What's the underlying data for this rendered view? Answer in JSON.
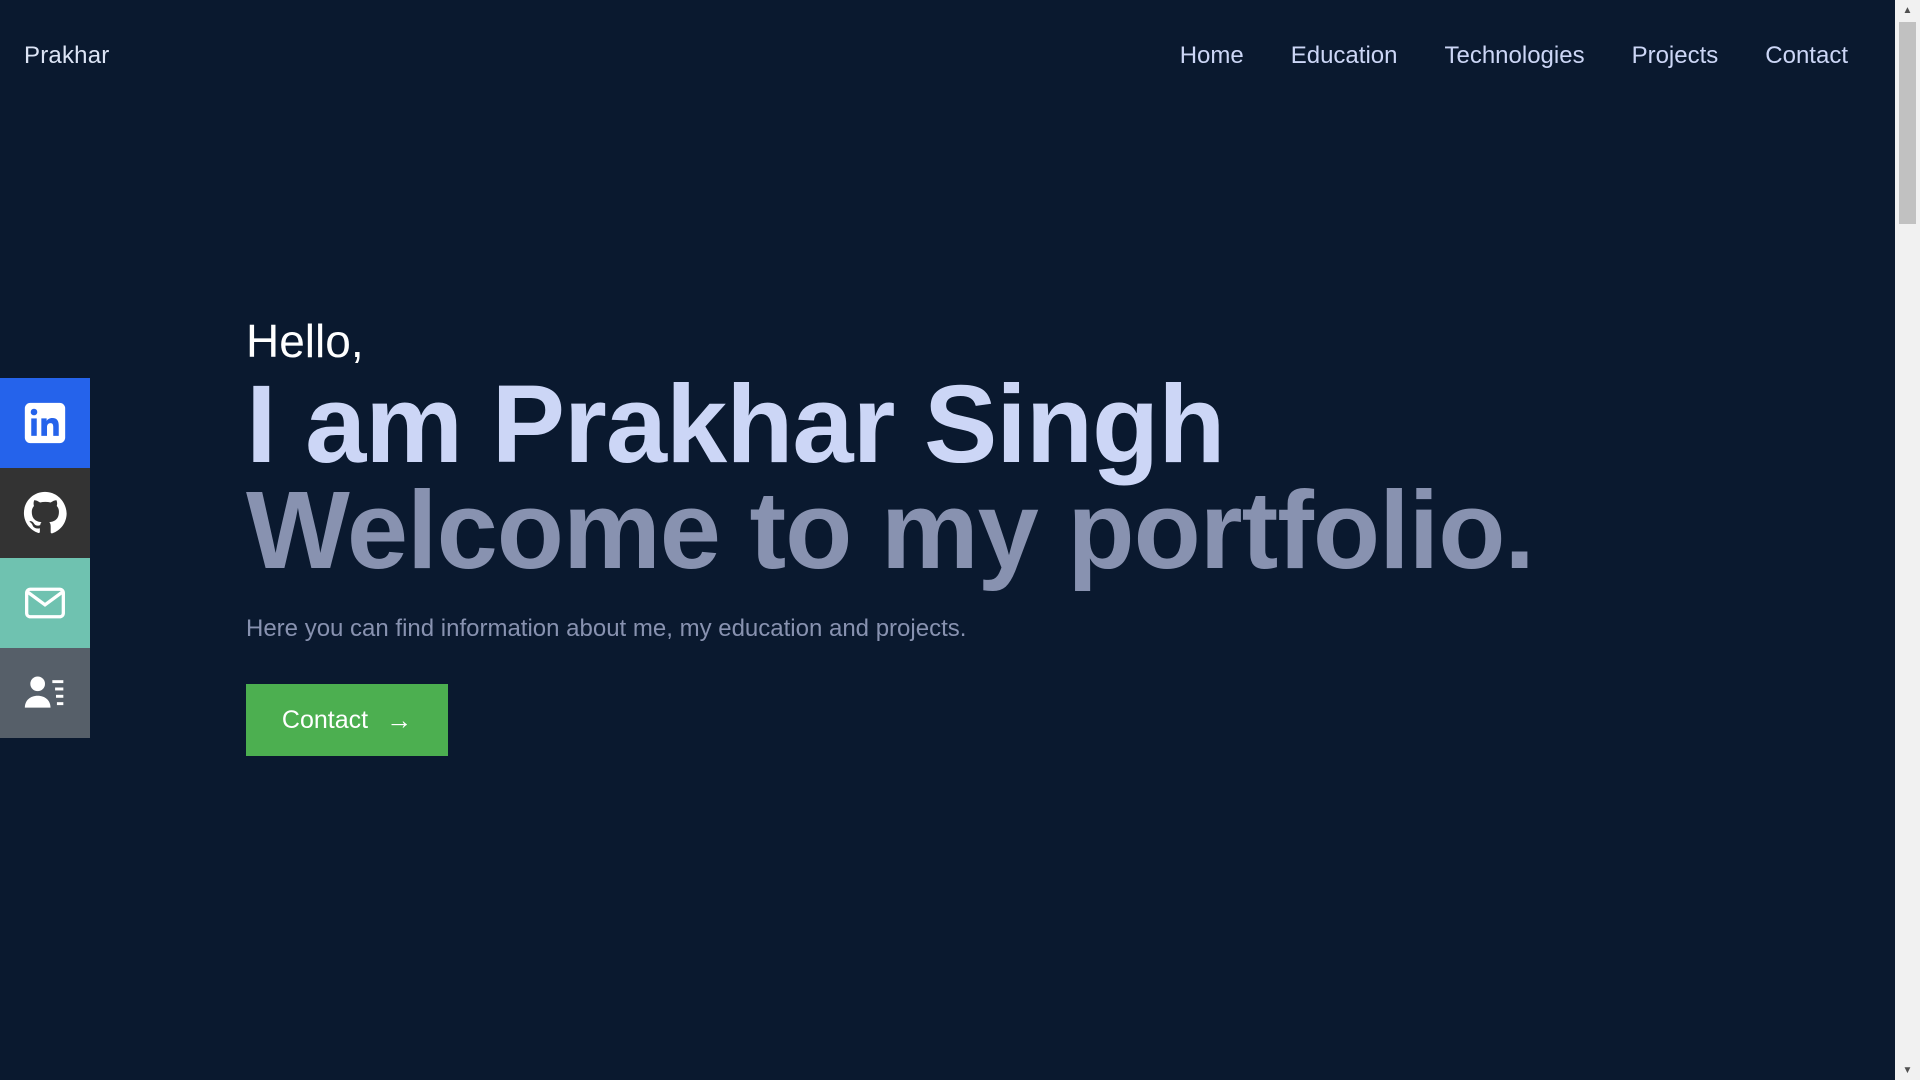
{
  "header": {
    "brand": "Prakhar",
    "nav": [
      "Home",
      "Education",
      "Technologies",
      "Projects",
      "Contact"
    ]
  },
  "social": {
    "items": [
      {
        "icon": "linkedin-icon",
        "color": "#2563eb"
      },
      {
        "icon": "github-icon",
        "color": "#333333"
      },
      {
        "icon": "mail-icon",
        "color": "#6fc2b0"
      },
      {
        "icon": "resume-icon",
        "color": "#565f69"
      }
    ]
  },
  "hero": {
    "greeting": "Hello,",
    "name_line": "I am Prakhar Singh",
    "welcome_line": "Welcome to my portfolio.",
    "subtitle": "Here you can find information about me, my education and projects.",
    "cta_label": "Contact",
    "cta_icon": "arrow-right-icon",
    "cta_color": "#4caf50"
  },
  "theme": {
    "background": "#0a192f",
    "primary_text": "#ccd6f6",
    "secondary_text": "#8892b0"
  }
}
